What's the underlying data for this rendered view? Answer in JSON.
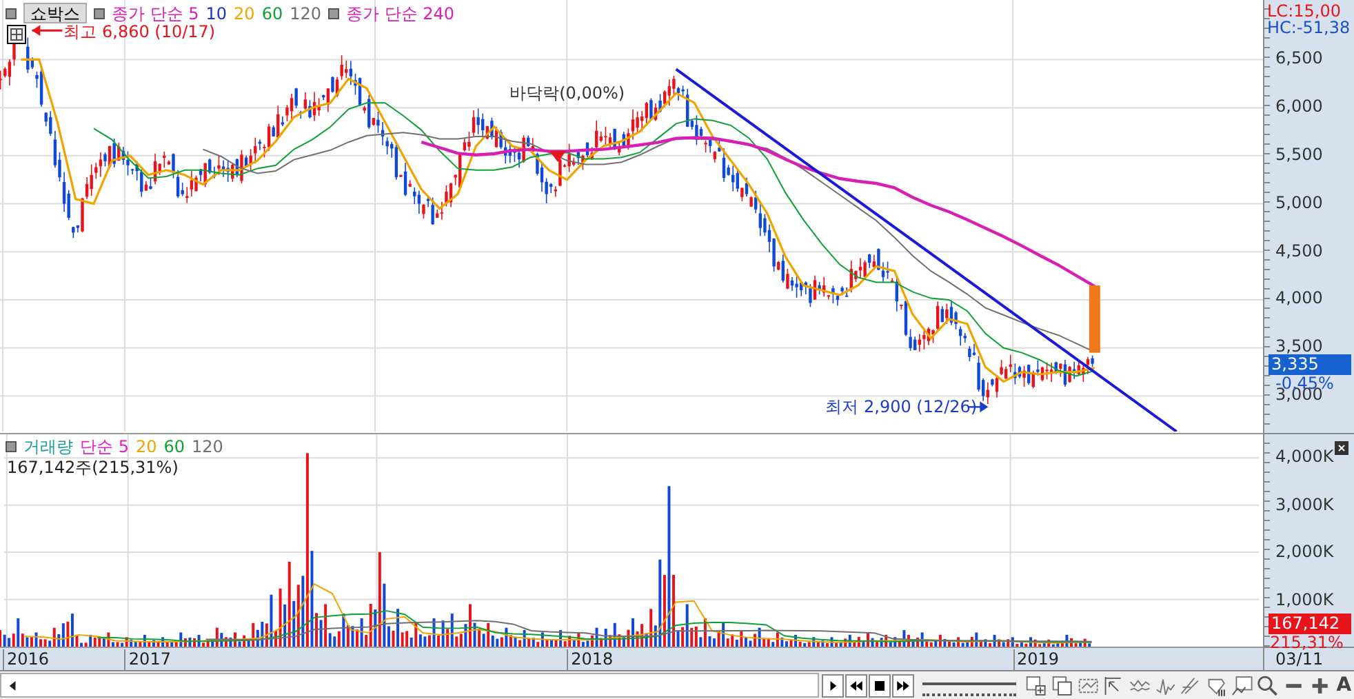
{
  "price_panel": {
    "stock_name": "쇼박스",
    "legend": [
      {
        "text": "종가 단순 5",
        "color": "#d81fb4"
      },
      {
        "text": "10",
        "color": "#1535c8"
      },
      {
        "text": "20",
        "color": "#f0a400"
      },
      {
        "text": "60",
        "color": "#10a035"
      },
      {
        "text": "120",
        "color": "#707070"
      }
    ],
    "legend_2": [
      {
        "text": "종가 단순 240",
        "color": "#d81fb4"
      }
    ],
    "lc": "LC:15,00",
    "hc": "HC:-51,38",
    "axis_labels": [
      "6,500",
      "6,000",
      "5,500",
      "5,000",
      "4,500",
      "4,000",
      "3,500",
      "3,000"
    ],
    "last_price": "3,335",
    "change": "-0,45%",
    "high_label": "최고 6,860 (10/17)",
    "low_label": "최저 2,900 (12/26)",
    "marker_label": "바닥락(0,00%)"
  },
  "volume_panel": {
    "legend": [
      {
        "text": "거래량",
        "color": "#1a9c9c"
      },
      {
        "text": "단순 5",
        "color": "#e020c0"
      },
      {
        "text": "20",
        "color": "#f0a400"
      },
      {
        "text": "60",
        "color": "#10a035"
      },
      {
        "text": "120",
        "color": "#707070"
      }
    ],
    "summary": "167,142주(215,31%)",
    "axis_labels": [
      "4,000K",
      "3,000K",
      "2,000K",
      "1,000K"
    ],
    "last_volume": "167,142",
    "ratio": "215,31%"
  },
  "date_axis": {
    "labels": [
      "2016",
      "2017",
      "2018",
      "2019"
    ],
    "current_date": "03/11"
  },
  "toolbar": {
    "slider": {
      "level": 1
    },
    "text_button": "A"
  }
}
